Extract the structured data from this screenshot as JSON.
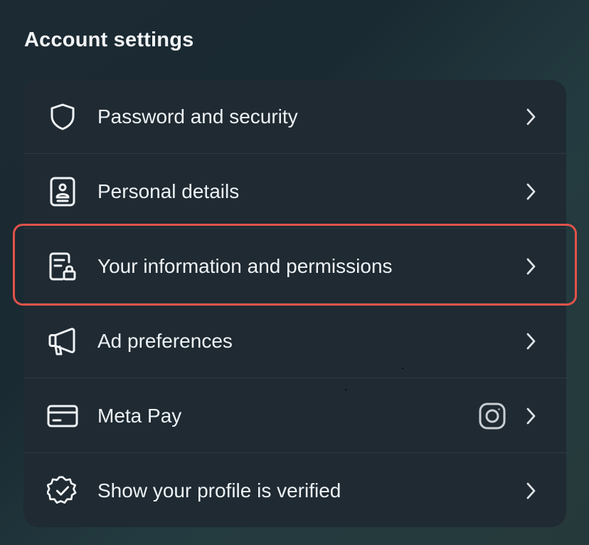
{
  "header": {
    "title": "Account settings"
  },
  "colors": {
    "card_background": "#1f2a32",
    "highlight_border": "#e0534a",
    "text": "#eef2f5",
    "divider": "#2e3a42"
  },
  "items": [
    {
      "label": "Password and security",
      "icon": "shield-icon",
      "trailing_icon": "chevron-right-icon"
    },
    {
      "label": "Personal details",
      "icon": "id-card-icon",
      "trailing_icon": "chevron-right-icon"
    },
    {
      "label": "Your information and permissions",
      "icon": "document-lock-icon",
      "trailing_icon": "chevron-right-icon",
      "highlighted": true
    },
    {
      "label": "Ad preferences",
      "icon": "megaphone-icon",
      "trailing_icon": "chevron-right-icon"
    },
    {
      "label": "Meta Pay",
      "icon": "credit-card-icon",
      "extra_icon": "instagram-icon",
      "trailing_icon": "chevron-right-icon"
    },
    {
      "label": "Show your profile is verified",
      "icon": "verified-badge-icon",
      "trailing_icon": "chevron-right-icon"
    }
  ]
}
